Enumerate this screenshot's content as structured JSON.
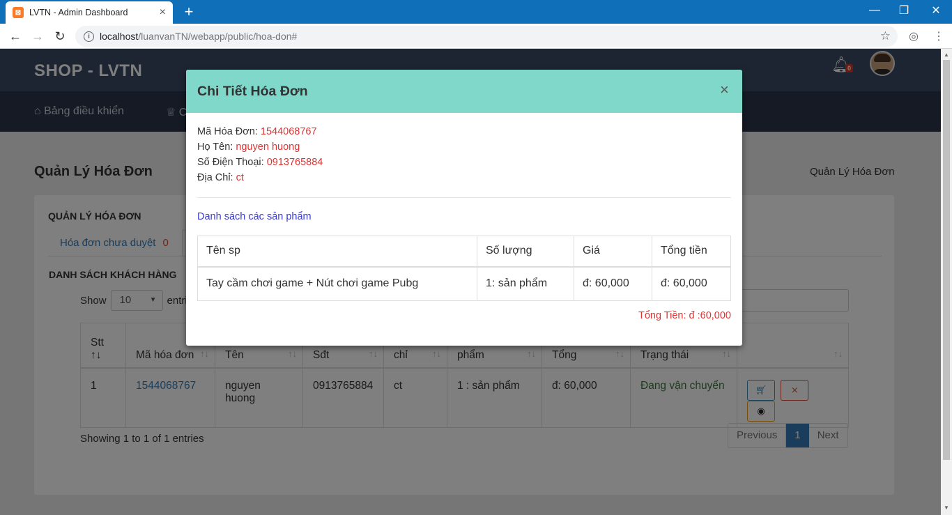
{
  "browser": {
    "tab_title": "LVTN - Admin Dashboard",
    "tab_close": "×",
    "new_tab": "+",
    "url_host": "localhost",
    "url_path": "/luanvanTN/webapp/public/hoa-don#"
  },
  "header": {
    "brand": "SHOP - LVTN",
    "notification_count": "0"
  },
  "nav": {
    "item1": "Bảng điều khiển",
    "item2": "C"
  },
  "content": {
    "title": "Quản Lý Hóa Đơn",
    "breadcrumb": "Quản Lý Hóa Đơn",
    "box_title": "QUẢN LÝ HÓA ĐƠN",
    "tab_pending_label": "Hóa đơn chưa duyệt",
    "tab_pending_count": "0",
    "list_title": "DANH SÁCH KHÁCH HÀNG",
    "show_label": "Show",
    "show_value": "10",
    "entries_label": "entries",
    "columns": [
      "Stt",
      "Mã hóa đơn",
      "Tên",
      "Sđt",
      "chỉ",
      "phẩm",
      "Tổng",
      "Trạng thái",
      ""
    ],
    "row": {
      "stt": "1",
      "ma": "1544068767",
      "ten": "nguyen huong",
      "sdt": "0913765884",
      "diachi": "ct",
      "sanpham": "1 : sản phẩm",
      "tong": "đ: 60,000",
      "trangthai": "Đang vận chuyển"
    },
    "showing": "Showing 1 to 1 of 1 entries",
    "pager": {
      "prev": "Previous",
      "current": "1",
      "next": "Next"
    }
  },
  "modal": {
    "title": "Chi Tiết Hóa Đơn",
    "close": "×",
    "ma_label": "Mã Hóa Đơn: ",
    "ma_value": "1544068767",
    "ten_label": "Họ Tên: ",
    "ten_value": "nguyen huong",
    "sdt_label": "Số Điện Thoại: ",
    "sdt_value": "0913765884",
    "diachi_label": "Địa Chỉ: ",
    "diachi_value": "ct",
    "products_title": "Danh sách các sản phẩm",
    "table_headers": [
      "Tên sp",
      "Số lượng",
      "Giá",
      "Tổng tiền"
    ],
    "table_row": [
      "Tay cầm chơi game + Nút chơi game Pubg",
      "1: sản phẩm",
      "đ: 60,000",
      "đ: 60,000"
    ],
    "total": "Tổng Tiền: đ :60,000"
  }
}
